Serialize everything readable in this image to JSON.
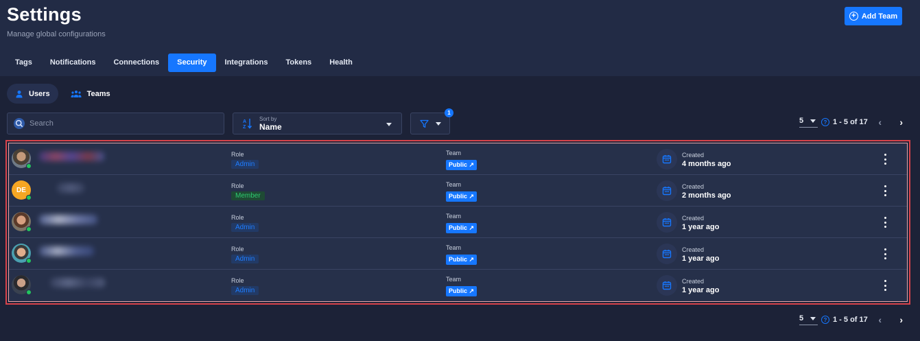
{
  "header": {
    "title": "Settings",
    "subtitle": "Manage global configurations",
    "add_team_label": "Add Team"
  },
  "tabs": [
    {
      "label": "Tags",
      "active": false
    },
    {
      "label": "Notifications",
      "active": false
    },
    {
      "label": "Connections",
      "active": false
    },
    {
      "label": "Security",
      "active": true
    },
    {
      "label": "Integrations",
      "active": false
    },
    {
      "label": "Tokens",
      "active": false
    },
    {
      "label": "Health",
      "active": false
    }
  ],
  "subtabs": [
    {
      "label": "Users",
      "icon": "user-icon",
      "active": true
    },
    {
      "label": "Teams",
      "icon": "team-icon",
      "active": false
    }
  ],
  "search": {
    "placeholder": "Search",
    "value": ""
  },
  "sort": {
    "small_label": "Sort by",
    "value": "Name"
  },
  "filter": {
    "badge_count": "1"
  },
  "pagination": {
    "page_size": "5",
    "range": "1 - 5 of 17"
  },
  "columns": {
    "role_label": "Role",
    "team_label": "Team",
    "created_label": "Created"
  },
  "rows": [
    {
      "avatar": "photo",
      "initials": "",
      "role": "Admin",
      "team": "Public ↗",
      "created": "4 months ago",
      "online": true
    },
    {
      "avatar": "initials",
      "initials": "DE",
      "role": "Member",
      "team": "Public ↗",
      "created": "2 months ago",
      "online": true
    },
    {
      "avatar": "photo",
      "initials": "",
      "role": "Admin",
      "team": "Public ↗",
      "created": "1 year ago",
      "online": true
    },
    {
      "avatar": "photo",
      "initials": "",
      "role": "Admin",
      "team": "Public ↗",
      "created": "1 year ago",
      "online": true
    },
    {
      "avatar": "photo",
      "initials": "",
      "role": "Admin",
      "team": "Public ↗",
      "created": "1 year ago",
      "online": true
    }
  ],
  "colors": {
    "accent": "#1677ff",
    "background": "#1c2237",
    "header_bg": "#222b45",
    "row_bg": "#26304a",
    "online": "#22c55e",
    "admin_text": "#1f7dff",
    "member_text": "#2ecc71",
    "highlight_border": "#d9434b",
    "initials_avatar": "#f5a623"
  }
}
